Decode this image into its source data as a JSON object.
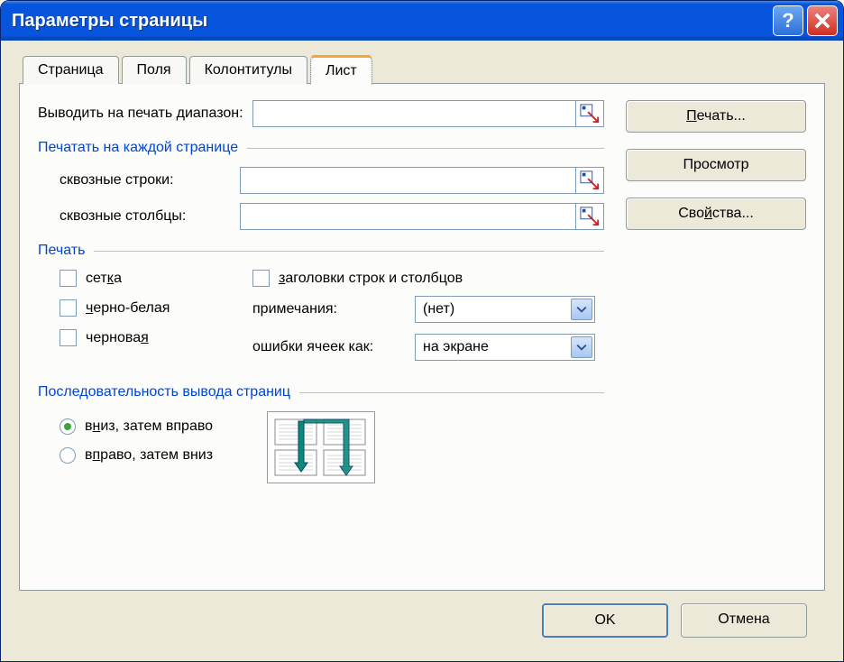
{
  "window": {
    "title": "Параметры страницы"
  },
  "tabs": {
    "page": "Страница",
    "margins": "Поля",
    "headerfooter": "Колонтитулы",
    "sheet": "Лист"
  },
  "sheet": {
    "print_range_label": "Выводить на печать диапазон:",
    "print_range_value": "",
    "repeat_group": "Печатать на каждой странице",
    "rows_label": "сквозные строки:",
    "rows_value": "",
    "cols_label": "сквозные столбцы:",
    "cols_value": "",
    "print_group": "Печать",
    "cb_grid": "сетка",
    "cb_bw": "черно-белая",
    "cb_draft": "черновая",
    "cb_headings": "заголовки строк и столбцов",
    "comments_label": "примечания:",
    "comments_value": "(нет)",
    "errors_label": "ошибки ячеек как:",
    "errors_value": "на экране",
    "order_group": "Последовательность вывода страниц",
    "order_down": "вниз, затем вправо",
    "order_over": "вправо, затем вниз"
  },
  "buttons": {
    "print": "Печать...",
    "preview": "Просмотр",
    "options": "Свойства...",
    "ok": "OK",
    "cancel": "Отмена"
  }
}
